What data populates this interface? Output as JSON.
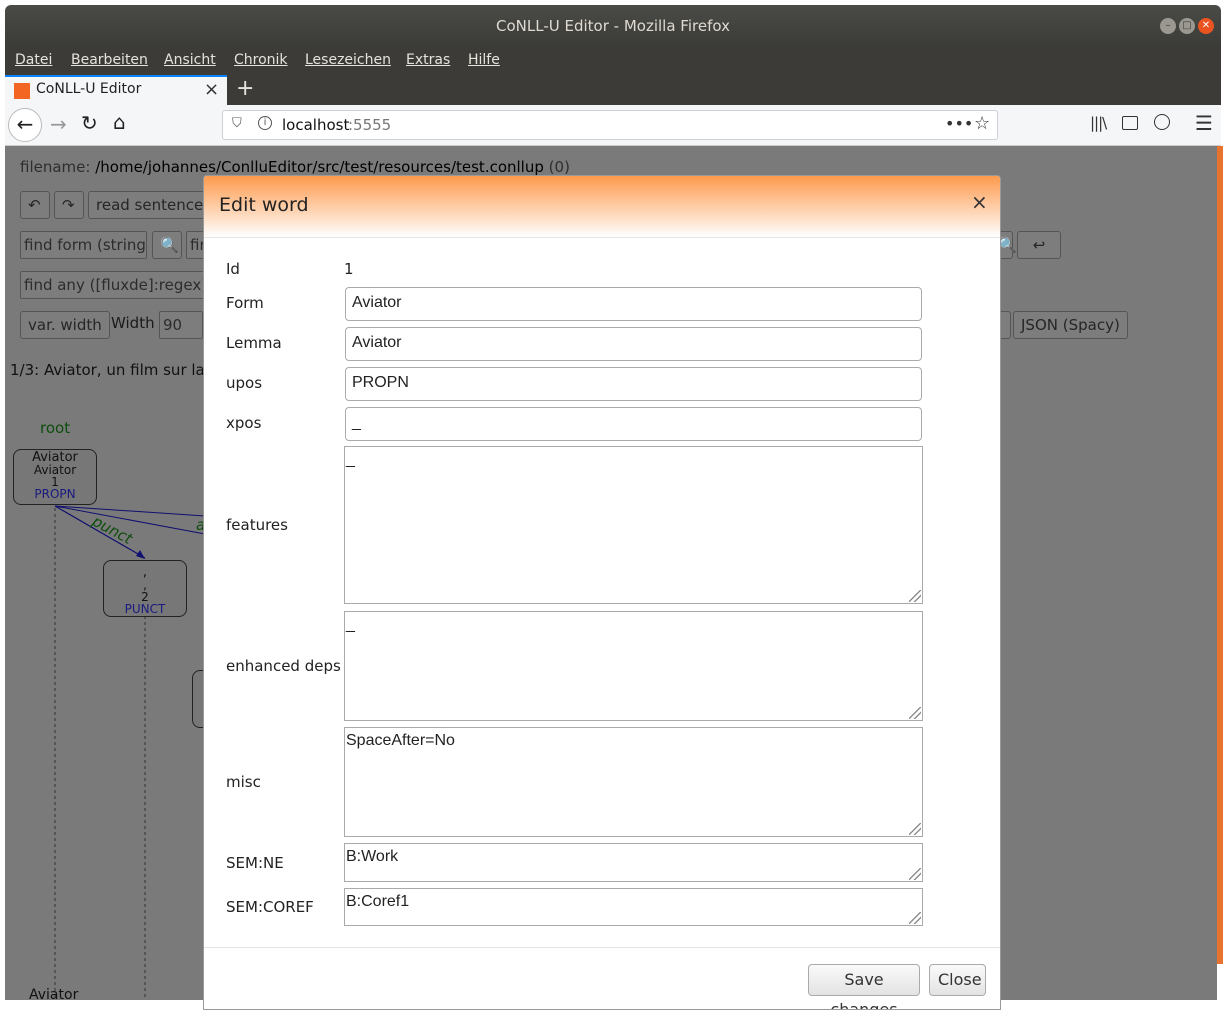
{
  "window": {
    "title": "CoNLL-U Editor - Mozilla Firefox"
  },
  "menu": [
    "Datei",
    "Bearbeiten",
    "Ansicht",
    "Chronik",
    "Lesezeichen",
    "Extras",
    "Hilfe"
  ],
  "tab": {
    "label": "CoNLL-U Editor",
    "close": "×",
    "new_tab": "+"
  },
  "url": {
    "host": "localhost",
    "port": ":5555"
  },
  "page": {
    "filename_label": "filename:",
    "filename_value": "/home/johannes/ConlluEditor/src/test/resources/test.conllup",
    "filename_count": "(0)",
    "read_sentence": "read sentence",
    "find_form": "find form (string)",
    "find_form2": "fir",
    "find_any": "find any ([fluxde]:regex)",
    "var_width": "var. width",
    "width_label": "Width",
    "width_value": "90",
    "json_spacy": "JSON (Spacy)",
    "sentence_prefix": "1/3",
    "sentence_text": ": Aviator, un film sur la v",
    "root": "root",
    "node1": {
      "form": "Aviator",
      "lemma": "Aviator",
      "id": "1",
      "upos": "PROPN"
    },
    "node2": {
      "form": ",",
      "lemma": ",",
      "id": "2",
      "upos": "PUNCT"
    },
    "edge_punct": "punct",
    "edge_a": "a",
    "bottom_word": "Aviator"
  },
  "dialog": {
    "title": "Edit word",
    "close_x": "×",
    "id_label": "Id",
    "id_value": "1",
    "form_label": "Form",
    "form_value": "Aviator",
    "lemma_label": "Lemma",
    "lemma_value": "Aviator",
    "upos_label": "upos",
    "upos_value": "PROPN",
    "xpos_label": "xpos",
    "xpos_value": "_",
    "features_label": "features",
    "features_value": "_",
    "edeps_label": "enhanced deps",
    "edeps_value": "_",
    "misc_label": "misc",
    "misc_value": "SpaceAfter=No",
    "semne_label": "SEM:NE",
    "semne_value": "B:Work",
    "semcoref_label": "SEM:COREF",
    "semcoref_value": "B:Coref1",
    "save": "Save changes",
    "close": "Close"
  }
}
